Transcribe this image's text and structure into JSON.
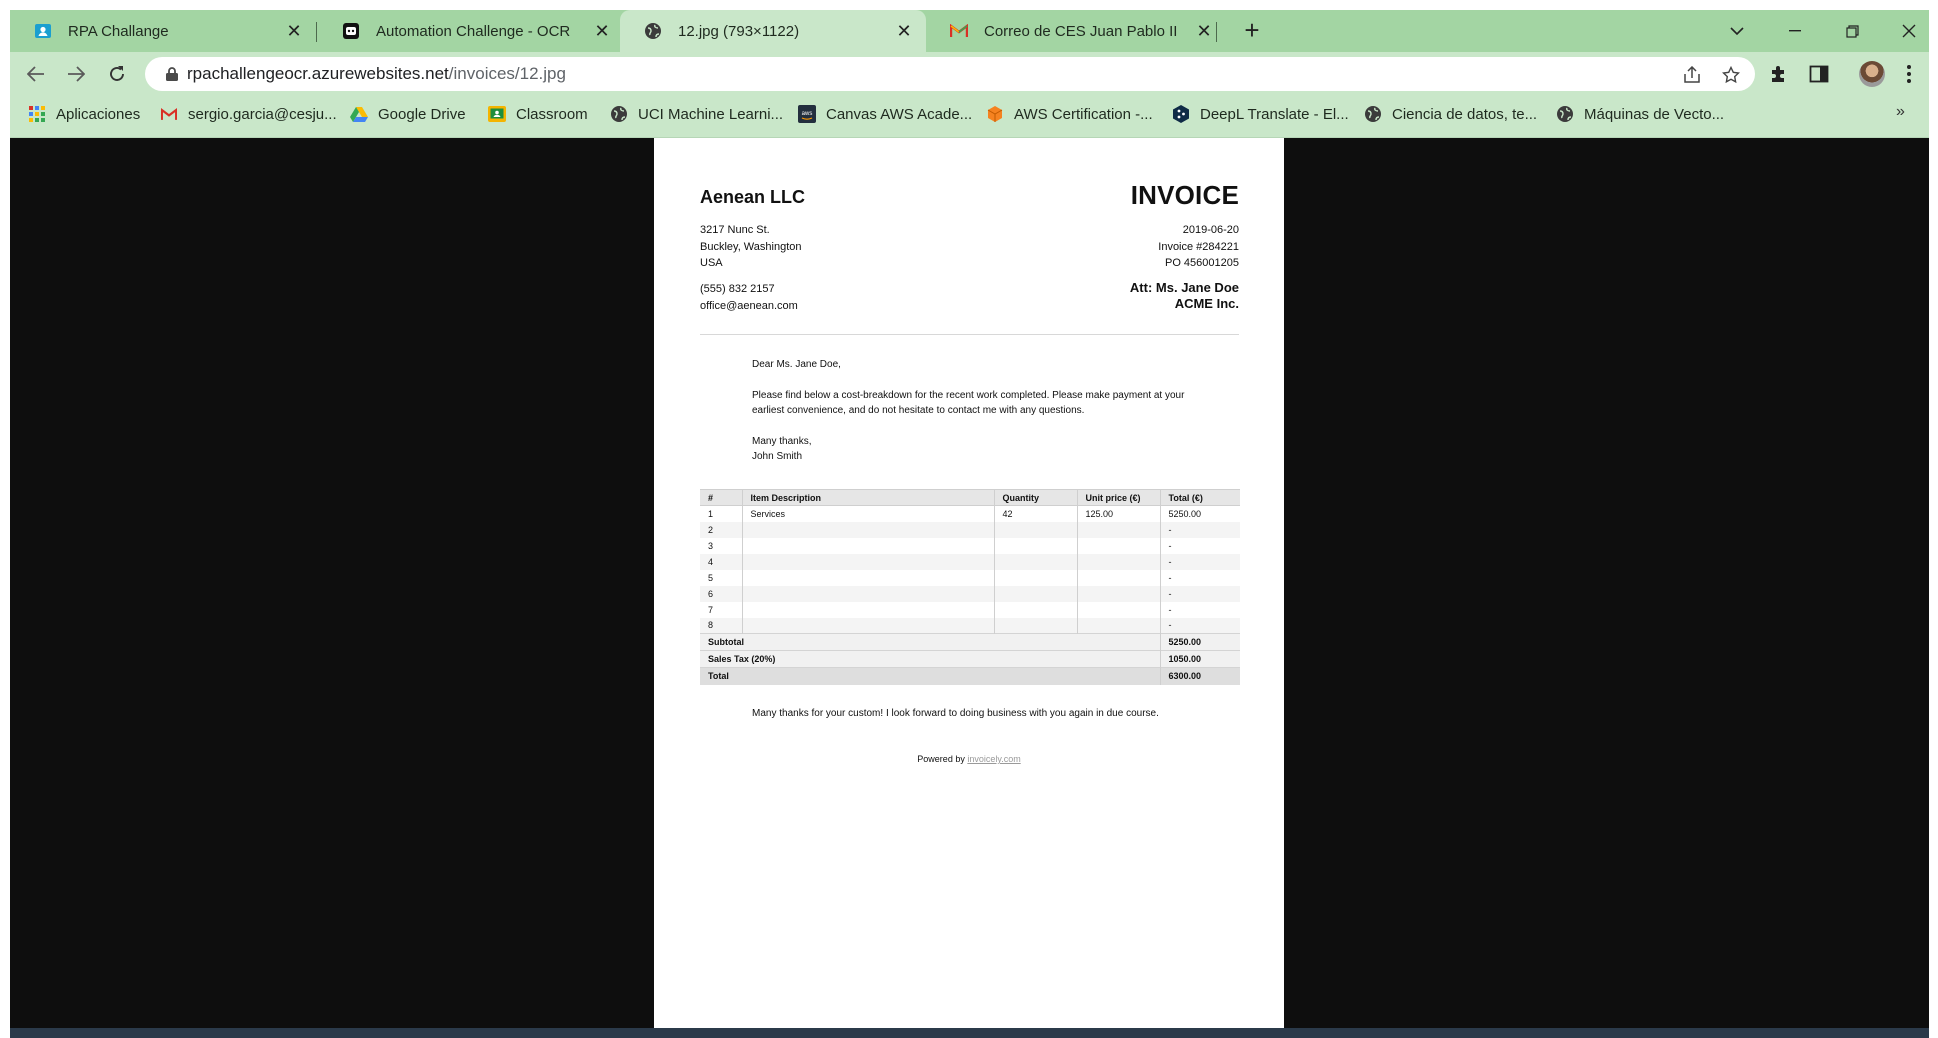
{
  "browser": {
    "tabs": [
      {
        "title": "RPA Challange",
        "active": false
      },
      {
        "title": "Automation Challenge - OCR",
        "active": false
      },
      {
        "title": "12.jpg (793×1122)",
        "active": true
      },
      {
        "title": "Correo de CES Juan Pablo II",
        "active": false
      }
    ],
    "url": {
      "host": "rpachallengeocr.azurewebsites.net",
      "path": "/invoices/12.jpg"
    },
    "bookmarks": [
      {
        "label": "Aplicaciones",
        "icon": "apps-grid-icon"
      },
      {
        "label": "sergio.garcia@cesju...",
        "icon": "gmail-icon"
      },
      {
        "label": "Google Drive",
        "icon": "google-drive-icon"
      },
      {
        "label": "Classroom",
        "icon": "classroom-icon"
      },
      {
        "label": "UCI Machine Learni...",
        "icon": "globe-icon"
      },
      {
        "label": "Canvas AWS Acade...",
        "icon": "aws-icon"
      },
      {
        "label": "AWS Certification -...",
        "icon": "aws-cube-icon"
      },
      {
        "label": "DeepL Translate - El...",
        "icon": "deepl-icon"
      },
      {
        "label": "Ciencia de datos, te...",
        "icon": "globe-icon"
      },
      {
        "label": "Máquinas de Vecto...",
        "icon": "globe-icon"
      }
    ],
    "colors": {
      "tabstrip": "#a3d5a3",
      "toolbar": "#c9e7c9",
      "viewer_bg": "#0e0e0e"
    }
  },
  "invoice": {
    "company": "Aenean LLC",
    "title": "INVOICE",
    "address": [
      "3217 Nunc St.",
      "Buckley, Washington",
      "USA"
    ],
    "phone": "(555) 832 2157",
    "email": "office@aenean.com",
    "date": "2019-06-20",
    "invoice_number": "Invoice #284221",
    "po": "PO 456001205",
    "att": "Att: Ms. Jane Doe",
    "client": "ACME Inc.",
    "greeting": "Dear Ms. Jane Doe,",
    "body": "Please find below a cost-breakdown for the recent work completed. Please make payment at your earliest convenience, and do not hesitate to contact me with any questions.",
    "signoff": "Many thanks,",
    "signer": "John Smith",
    "columns": [
      "#",
      "Item Description",
      "Quantity",
      "Unit price (€)",
      "Total (€)"
    ],
    "rows": [
      [
        "1",
        "Services",
        "42",
        "125.00",
        "5250.00"
      ],
      [
        "2",
        "",
        "",
        "",
        "-"
      ],
      [
        "3",
        "",
        "",
        "",
        "-"
      ],
      [
        "4",
        "",
        "",
        "",
        "-"
      ],
      [
        "5",
        "",
        "",
        "",
        "-"
      ],
      [
        "6",
        "",
        "",
        "",
        "-"
      ],
      [
        "7",
        "",
        "",
        "",
        "-"
      ],
      [
        "8",
        "",
        "",
        "",
        "-"
      ]
    ],
    "subtotal_label": "Subtotal",
    "subtotal": "5250.00",
    "tax_label": "Sales Tax (20%)",
    "tax": "1050.00",
    "total_label": "Total",
    "total": "6300.00",
    "closing": "Many thanks for your custom! I look forward to doing business with you again in due course.",
    "powered_prefix": "Powered by",
    "powered_link": "invoicely.com"
  }
}
